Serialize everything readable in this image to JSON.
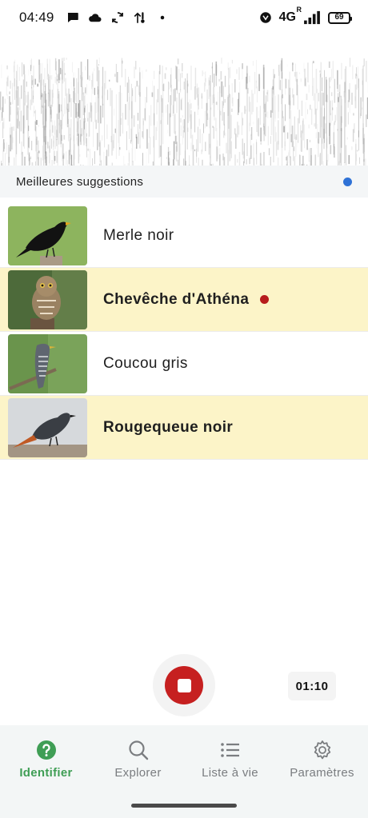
{
  "status_bar": {
    "time": "04:49",
    "network": "4G",
    "roaming": "R",
    "battery": "69",
    "icons": [
      "chat-icon",
      "cloud-icon",
      "sync-icon",
      "data-arrow-icon",
      "notification-dot-icon",
      "vibrate-icon",
      "signal-icon",
      "battery-icon"
    ]
  },
  "suggestions": {
    "header": "Meilleures suggestions",
    "indicator_color": "#2f72d6",
    "items": [
      {
        "name": "Merle noir",
        "highlight": false,
        "recording": false
      },
      {
        "name": "Chevêche d'Athéna",
        "highlight": true,
        "recording": true
      },
      {
        "name": "Coucou gris",
        "highlight": false,
        "recording": false
      },
      {
        "name": "Rougequeue noir",
        "highlight": true,
        "recording": false
      }
    ]
  },
  "recorder": {
    "timer": "01:10",
    "stop_color": "#c62020"
  },
  "nav": {
    "items": [
      {
        "label": "Identifier",
        "icon": "help-circle-icon",
        "active": true
      },
      {
        "label": "Explorer",
        "icon": "search-icon",
        "active": false
      },
      {
        "label": "Liste à vie",
        "icon": "list-icon",
        "active": false
      },
      {
        "label": "Paramètres",
        "icon": "gear-icon",
        "active": false
      }
    ],
    "active_color": "#3f9e55"
  },
  "colors": {
    "highlight_row": "#fcf4c8",
    "recording_dot": "#b71c1c"
  }
}
